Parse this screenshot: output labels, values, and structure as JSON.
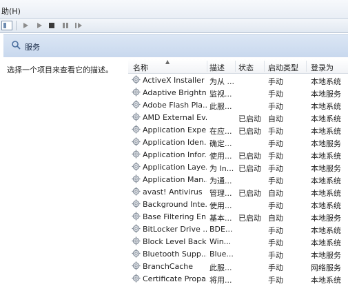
{
  "menubar": {
    "help_label": "助(H)"
  },
  "pane": {
    "title": "服务",
    "left_description": "选择一个项目来查看它的描述。"
  },
  "table": {
    "columns": {
      "name": "名称",
      "desc": "描述",
      "status": "状态",
      "startup": "启动类型",
      "logon": "登录为"
    },
    "rows": [
      {
        "name": "ActiveX Installer ...",
        "desc": "为从 ...",
        "status": "",
        "startup": "手动",
        "logon": "本地系统"
      },
      {
        "name": "Adaptive Brightn...",
        "desc": "监视...",
        "status": "",
        "startup": "手动",
        "logon": "本地服务"
      },
      {
        "name": "Adobe Flash Pla...",
        "desc": "此服...",
        "status": "",
        "startup": "手动",
        "logon": "本地系统"
      },
      {
        "name": "AMD External Ev...",
        "desc": "",
        "status": "已启动",
        "startup": "自动",
        "logon": "本地系统"
      },
      {
        "name": "Application Expe...",
        "desc": "在应...",
        "status": "已启动",
        "startup": "手动",
        "logon": "本地系统"
      },
      {
        "name": "Application Iden...",
        "desc": "确定...",
        "status": "",
        "startup": "手动",
        "logon": "本地服务"
      },
      {
        "name": "Application Infor...",
        "desc": "使用...",
        "status": "已启动",
        "startup": "手动",
        "logon": "本地系统"
      },
      {
        "name": "Application Laye...",
        "desc": "为 In...",
        "status": "已启动",
        "startup": "手动",
        "logon": "本地服务"
      },
      {
        "name": "Application Man...",
        "desc": "为通...",
        "status": "",
        "startup": "手动",
        "logon": "本地系统"
      },
      {
        "name": "avast! Antivirus",
        "desc": "管理...",
        "status": "已启动",
        "startup": "自动",
        "logon": "本地系统"
      },
      {
        "name": "Background Inte...",
        "desc": "使用...",
        "status": "",
        "startup": "手动",
        "logon": "本地系统"
      },
      {
        "name": "Base Filtering En...",
        "desc": "基本...",
        "status": "已启动",
        "startup": "自动",
        "logon": "本地服务"
      },
      {
        "name": "BitLocker Drive ...",
        "desc": "BDE...",
        "status": "",
        "startup": "手动",
        "logon": "本地系统"
      },
      {
        "name": "Block Level Back...",
        "desc": "Win...",
        "status": "",
        "startup": "手动",
        "logon": "本地系统"
      },
      {
        "name": "Bluetooth Supp...",
        "desc": "Blue...",
        "status": "",
        "startup": "手动",
        "logon": "本地服务"
      },
      {
        "name": "BranchCache",
        "desc": "此服...",
        "status": "",
        "startup": "手动",
        "logon": "网络服务"
      },
      {
        "name": "Certificate Propa...",
        "desc": "将用...",
        "status": "",
        "startup": "手动",
        "logon": "本地系统"
      }
    ]
  },
  "icons": {
    "row_icon": "gear-icon",
    "pane_icon": "search-icon"
  }
}
